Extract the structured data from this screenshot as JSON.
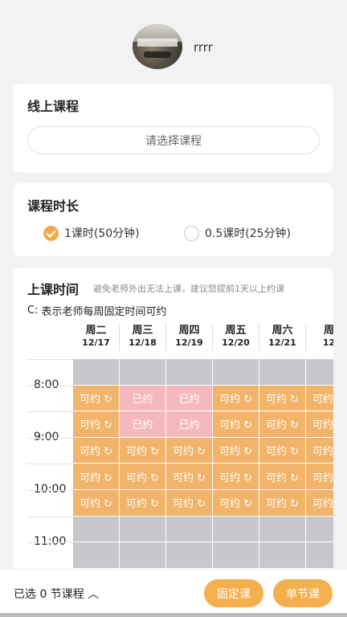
{
  "profile": {
    "username": "rrrr"
  },
  "online_course": {
    "title": "线上课程",
    "placeholder": "请选择课程"
  },
  "duration": {
    "title": "课程时长",
    "options": [
      {
        "label": "1课时(50分钟)",
        "selected": true
      },
      {
        "label": "0.5课时(25分钟)",
        "selected": false
      }
    ]
  },
  "schedule": {
    "title": "上课时间",
    "hint": "避免老师外出无法上课，建议您提前1天以上约课",
    "legend": "表示老师每周固定时间可约",
    "days": [
      {
        "name": "周二",
        "date": "12/17"
      },
      {
        "name": "周三",
        "date": "12/18"
      },
      {
        "name": "周四",
        "date": "12/19"
      },
      {
        "name": "周五",
        "date": "12/20"
      },
      {
        "name": "周六",
        "date": "12/21"
      },
      {
        "name": "周",
        "date": "12"
      }
    ],
    "times": [
      "8:00",
      "9:00",
      "10:00",
      "11:00"
    ],
    "slot_labels": {
      "available": "可约",
      "booked": "已约"
    },
    "rows": [
      [
        "gray",
        "gray",
        "gray",
        "gray",
        "gray",
        "gray"
      ],
      [
        "avail",
        "booked",
        "booked",
        "avail",
        "avail",
        "avail"
      ],
      [
        "avail",
        "booked",
        "booked",
        "avail",
        "avail",
        "avail"
      ],
      [
        "avail",
        "avail",
        "avail",
        "avail",
        "avail",
        "avail"
      ],
      [
        "avail",
        "avail",
        "avail",
        "avail",
        "avail",
        "avail"
      ],
      [
        "avail",
        "avail",
        "avail",
        "avail",
        "avail",
        "avail"
      ],
      [
        "gray",
        "gray",
        "gray",
        "gray",
        "gray",
        "gray"
      ],
      [
        "gray",
        "gray",
        "gray",
        "gray",
        "gray",
        "gray"
      ]
    ]
  },
  "bottom": {
    "selected_text": "已选 0 节课程 ︿",
    "fixed_button": "固定课",
    "single_button": "单节课"
  },
  "colors": {
    "accent": "#f4b04f",
    "available": "#f2b46a",
    "booked": "#f4b8bd",
    "unavailable": "#c6c7ca"
  }
}
